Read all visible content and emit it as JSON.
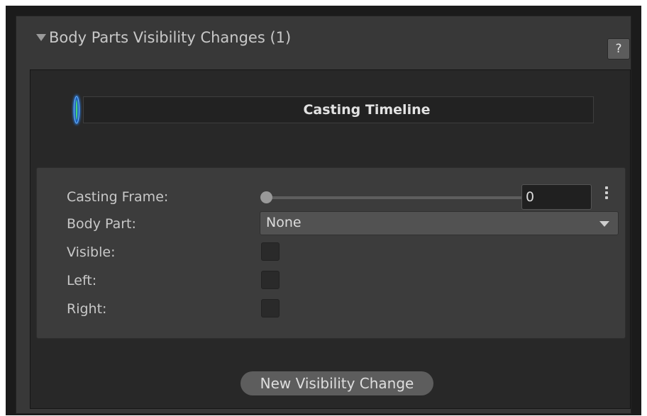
{
  "section": {
    "title": "Body Parts Visibility Changes (1)",
    "help_label": "?"
  },
  "timeline": {
    "label": "Casting Timeline"
  },
  "entry": {
    "casting_frame_label": "Casting Frame:",
    "casting_frame_value": "0",
    "casting_frame_slider_fraction": 0,
    "body_part_label": "Body Part:",
    "body_part_value": "None",
    "visible_label": "Visible:",
    "visible_checked": false,
    "left_label": "Left:",
    "left_checked": false,
    "right_label": "Right:",
    "right_checked": false
  },
  "actions": {
    "new_change_label": "New Visibility Change"
  },
  "colors": {
    "panel_bg": "#383838",
    "inner_bg": "#282828",
    "entry_bg": "#3c3c3c",
    "timeline_handle_glow": "#2f8cff",
    "text": "#c8c8c8"
  },
  "icons": {
    "foldout": "foldout-arrow-icon",
    "help": "help-icon",
    "menu": "kebab-menu-icon",
    "dropdown": "chevron-down-icon"
  }
}
